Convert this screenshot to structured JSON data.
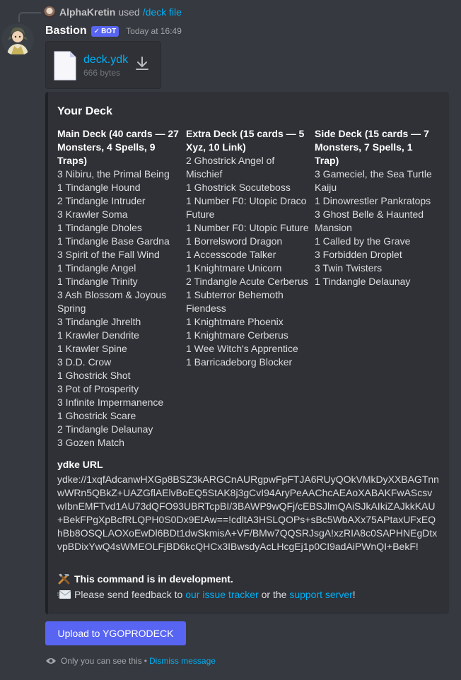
{
  "reply": {
    "user": "AlphaKretin",
    "text": "used",
    "command": "/deck file"
  },
  "message": {
    "username": "Bastion",
    "bot_tag": "BOT",
    "timestamp": "Today at 16:49"
  },
  "attachment": {
    "name": "deck.ydk",
    "size": "666 bytes"
  },
  "embed": {
    "title": "Your Deck",
    "fields": [
      {
        "name": "Main Deck (40 cards — 27 Monsters, 4 Spells, 9 Traps)",
        "items": [
          "3 Nibiru, the Primal Being",
          "1 Tindangle Hound",
          "2 Tindangle Intruder",
          "3 Krawler Soma",
          "1 Tindangle Dholes",
          "1 Tindangle Base Gardna",
          "3 Spirit of the Fall Wind",
          "1 Tindangle Angel",
          "1 Tindangle Trinity",
          "3 Ash Blossom & Joyous Spring",
          "3 Tindangle Jhrelth",
          "1 Krawler Dendrite",
          "1 Krawler Spine",
          "3 D.D. Crow",
          "1 Ghostrick Shot",
          "3 Pot of Prosperity",
          "3 Infinite Impermanence",
          "1 Ghostrick Scare",
          "2 Tindangle Delaunay",
          "3 Gozen Match"
        ]
      },
      {
        "name": "Extra Deck (15 cards — 5 Xyz, 10 Link)",
        "items": [
          "2 Ghostrick Angel of Mischief",
          "1 Ghostrick Socuteboss",
          "1 Number F0: Utopic Draco Future",
          "1 Number F0: Utopic Future",
          "1 Borrelsword Dragon",
          "1 Accesscode Talker",
          "1 Knightmare Unicorn",
          "2 Tindangle Acute Cerberus",
          "1 Subterror Behemoth Fiendess",
          "1 Knightmare Phoenix",
          "1 Knightmare Cerberus",
          "1 Wee Witch's Apprentice",
          "1 Barricadeborg Blocker"
        ]
      },
      {
        "name": "Side Deck (15 cards — 7 Monsters, 7 Spells, 1 Trap)",
        "items": [
          "3 Gameciel, the Sea Turtle Kaiju",
          "1 Dinowrestler Pankratops",
          "3 Ghost Belle & Haunted Mansion",
          "1 Called by the Grave",
          "3 Forbidden Droplet",
          "3 Twin Twisters",
          "1 Tindangle Delaunay"
        ]
      }
    ],
    "ydke_title": "ydke URL",
    "ydke_value": "ydke://1xqfAdcanwHXGp8BSZ3kARGCnAURgpwFpFTJA6RUyQOkVMkDyXXBAGTnnwWRn5QBkZ+UAZGflAElvBoEQ5StAK8j3gCvI94AryPeAAChcAEAoXABAKFwAScsvwIbnEMFTvd1AU73dQFO93UBRTcpBI/3BAWP9wQFj/cEBSJlmQAiSJkAIkiZAJkkKAU+BekFPgXpBcfRLQPH0S0Dx9EtAw==!cdltA3HSLQOPs+sBc5WbAXx75APtaxUFxEQhBb8OSQLAOXoEwDl6BDt1dwSkmisA+VF/BMw7QQSRJsgA!xzRIA8c0SAPHNEgDtxvpBDixYwQ4sWMEOLFjBD6kcQHCx3IBwsdyAcLHcgEj1p0CI9adAiPWnQI+BekF!",
    "dev_note": "This command is in development.",
    "feedback": {
      "prefix": "Please send feedback to",
      "link1": "our issue tracker",
      "middle": "or the",
      "link2": "support server",
      "suffix": "!"
    }
  },
  "button": {
    "label": "Upload to YGOPRODECK"
  },
  "footer": {
    "text": "Only you can see this",
    "separator": "•",
    "link": "Dismiss message"
  },
  "colors": {
    "background": "#36393f",
    "embed_background": "#2f3136",
    "link": "#00aff4",
    "blurple": "#5865f2"
  }
}
